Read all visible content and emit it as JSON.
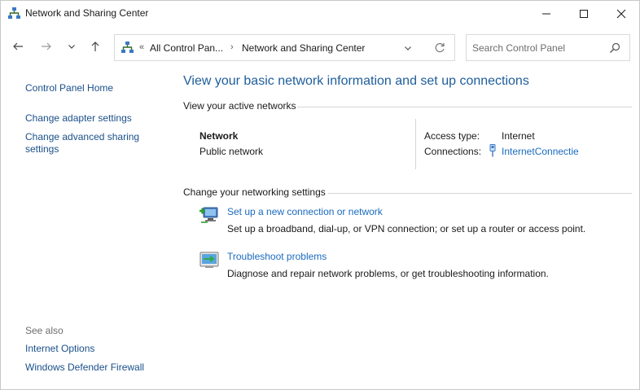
{
  "window": {
    "title": "Network and Sharing Center",
    "icon": "network-center-icon",
    "controls": [
      "minimize-icon",
      "maximize-icon",
      "close-icon"
    ]
  },
  "navigation": {
    "back_icon": "arrow-left-icon",
    "forward_icon": "arrow-right-icon",
    "recent_icon": "chevron-down-icon",
    "up_icon": "arrow-up-icon",
    "address": {
      "overflow_chevron": "«",
      "crumbs": [
        "All Control Pan...",
        "Network and Sharing Center"
      ],
      "separator": "›"
    },
    "search": {
      "placeholder": "Search Control Panel"
    }
  },
  "sidebar": {
    "home": "Control Panel Home",
    "adapter": "Change adapter settings",
    "advanced": "Change advanced sharing settings",
    "see_also_title": "See also",
    "see_also": [
      "Internet Options",
      "Windows Defender Firewall"
    ]
  },
  "main": {
    "title": "View your basic network information and set up connections",
    "active_networks": {
      "heading": "View your active networks",
      "network_name": "Network",
      "network_type": "Public network",
      "access_type_label": "Access type:",
      "access_type_value": "Internet",
      "connections_label": "Connections:",
      "connection_name": "InternetConnectie"
    },
    "change_settings": {
      "heading": "Change your networking settings",
      "tasks": [
        {
          "icon": "new-connection-icon",
          "link": "Set up a new connection or network",
          "description": "Set up a broadband, dial-up, or VPN connection; or set up a router or access point."
        },
        {
          "icon": "troubleshoot-icon",
          "link": "Troubleshoot problems",
          "description": "Diagnose and repair network problems, or get troubleshooting information."
        }
      ]
    }
  },
  "colors": {
    "link": "#1a6bbf",
    "title_blue": "#1e5d9a",
    "sidebar_link": "#1a4f8a",
    "muted": "#6d6d6d"
  }
}
